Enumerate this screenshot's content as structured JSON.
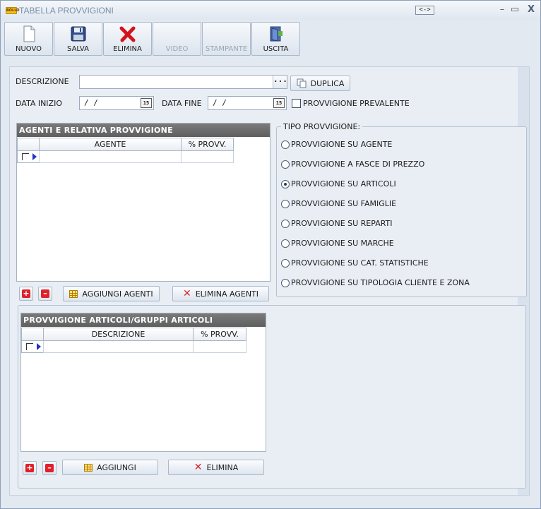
{
  "window": {
    "title": "TABELLA PROVVIGIONI",
    "app_icon_text": "BOLLO",
    "resize_label": "<->",
    "min_glyph": "–",
    "max_glyph": "▭",
    "close_glyph": "X"
  },
  "toolbar": {
    "buttons": [
      {
        "label": "NUOVO",
        "icon": "new-document-icon",
        "enabled": true
      },
      {
        "label": "SALVA",
        "icon": "floppy-disk-icon",
        "enabled": true
      },
      {
        "label": "ELIMINA",
        "icon": "red-x-icon",
        "enabled": true
      },
      {
        "label": "VIDEO",
        "icon": "none",
        "enabled": false
      },
      {
        "label": "STAMPANTE",
        "icon": "none",
        "enabled": false
      },
      {
        "label": "USCITA",
        "icon": "exit-door-icon",
        "enabled": true
      }
    ]
  },
  "form": {
    "descrizione_label": "DESCRIZIONE",
    "descrizione_value": "",
    "dots_label": "...",
    "duplica_label": "DUPLICA",
    "data_inizio_label": "DATA INIZIO",
    "data_inizio_value": " / /",
    "data_fine_label": "DATA FINE",
    "data_fine_value": " / /",
    "calendar_glyph": "15",
    "prevalente_label": "PROVVIGIONE PREVALENTE",
    "prevalente_checked": false
  },
  "agenti": {
    "title": "AGENTI E RELATIVA PROVVIGIONE",
    "columns": [
      "AGENTE",
      "% PROVV."
    ],
    "rows": [
      [
        "",
        ""
      ]
    ],
    "add_glyph": "+",
    "remove_glyph": "–",
    "add_button": "AGGIUNGI AGENTI",
    "delete_button": "ELIMINA AGENTI"
  },
  "tipo": {
    "legend": "TIPO PROVVIGIONE:",
    "options": [
      {
        "label": "PROVVIGIONE SU AGENTE",
        "checked": false
      },
      {
        "label": "PROVVIGIONE A FASCE DI PREZZO",
        "checked": false
      },
      {
        "label": "PROVVIGIONE SU ARTICOLI",
        "checked": true
      },
      {
        "label": "PROVVIGIONE SU FAMIGLIE",
        "checked": false
      },
      {
        "label": "PROVVIGIONE SU REPARTI",
        "checked": false
      },
      {
        "label": "PROVVIGIONE SU MARCHE",
        "checked": false
      },
      {
        "label": "PROVVIGIONE SU CAT. STATISTICHE",
        "checked": false
      },
      {
        "label": "PROVVIGIONE SU TIPOLOGIA CLIENTE E ZONA",
        "checked": false
      }
    ]
  },
  "articoli": {
    "title": "PROVVIGIONE ARTICOLI/GRUPPI ARTICOLI",
    "columns": [
      "DESCRIZIONE",
      "% PROVV."
    ],
    "rows": [
      [
        "",
        ""
      ]
    ],
    "add_glyph": "+",
    "remove_glyph": "–",
    "add_button": "AGGIUNGI",
    "delete_button": "ELIMINA"
  },
  "colors": {
    "accent_red": "#e0202a",
    "title_grey": "#6b6b6b",
    "row_arrow": "#2232c0"
  }
}
